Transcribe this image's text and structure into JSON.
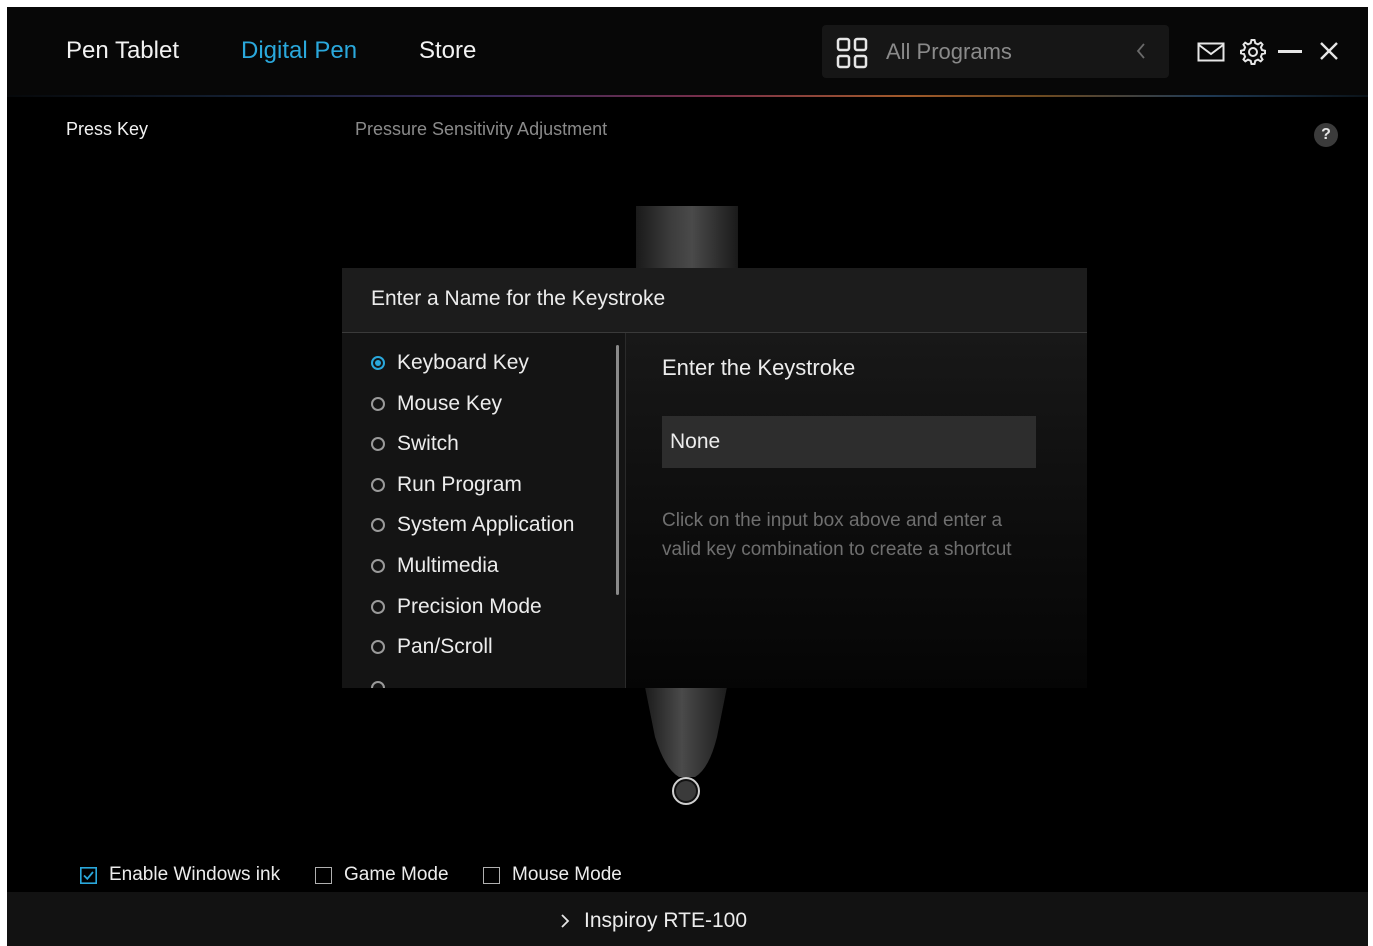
{
  "nav": {
    "tabs": [
      {
        "label": "Pen Tablet"
      },
      {
        "label": "Digital Pen"
      },
      {
        "label": "Store"
      }
    ],
    "active_tab": "Digital Pen",
    "program_selector": {
      "placeholder": "All Programs"
    }
  },
  "subheader": {
    "press_key": "Press Key",
    "pressure": "Pressure Sensitivity Adjustment",
    "help": "?"
  },
  "dialog": {
    "title": "Enter a Name for the Keystroke",
    "options": [
      {
        "label": "Keyboard Key",
        "selected": true
      },
      {
        "label": "Mouse Key",
        "selected": false
      },
      {
        "label": "Switch",
        "selected": false
      },
      {
        "label": "Run Program",
        "selected": false
      },
      {
        "label": "System Application",
        "selected": false
      },
      {
        "label": "Multimedia",
        "selected": false
      },
      {
        "label": "Precision Mode",
        "selected": false
      },
      {
        "label": "Pan/Scroll",
        "selected": false
      }
    ],
    "keystroke": {
      "title": "Enter the Keystroke",
      "value": "None",
      "hint": "Click on the input box above and enter a valid key combination to create a shortcut"
    }
  },
  "options_bar": {
    "enable_windows_ink": {
      "label": "Enable Windows ink",
      "checked": true
    },
    "game_mode": {
      "label": "Game Mode",
      "checked": false
    },
    "mouse_mode": {
      "label": "Mouse Mode",
      "checked": false
    }
  },
  "footer": {
    "device": "Inspiroy RTE-100"
  },
  "colors": {
    "accent": "#2aa8dc",
    "background": "#000000",
    "text": "#ececec"
  },
  "icons": [
    "grid-icon",
    "chevron-left-icon",
    "mail-icon",
    "gear-icon",
    "minimize-icon",
    "close-icon",
    "chevron-right-icon"
  ]
}
